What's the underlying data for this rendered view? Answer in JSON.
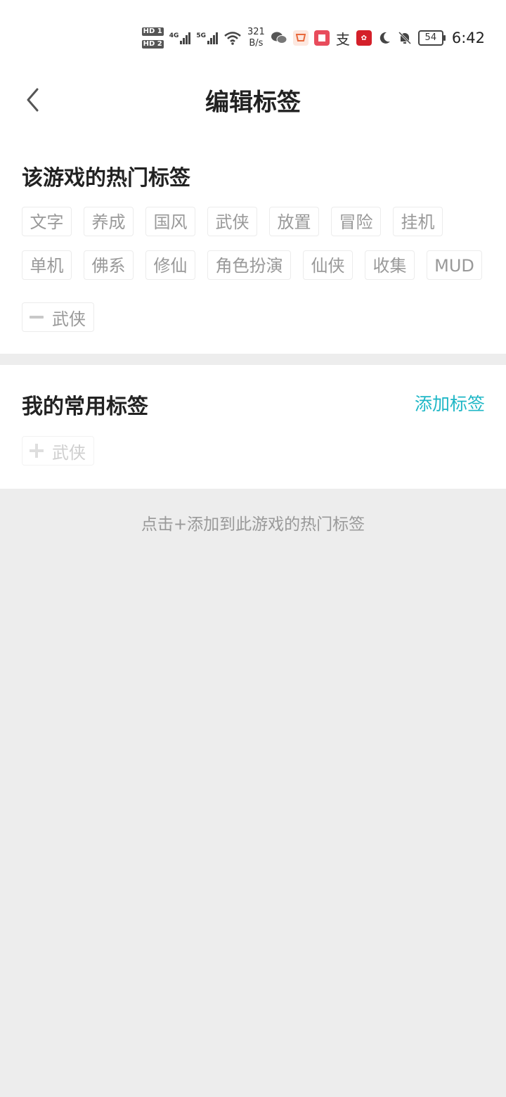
{
  "status_bar": {
    "hd1": "HD 1",
    "hd2": "HD 2",
    "net1": "4G",
    "net2": "5G",
    "speed_value": "321",
    "speed_unit": "B/s",
    "zhi_label": "支",
    "battery": "54",
    "time": "6:42"
  },
  "header": {
    "title": "编辑标签"
  },
  "hot_section": {
    "title": "该游戏的热门标签",
    "tags": [
      "文字",
      "养成",
      "国风",
      "武侠",
      "放置",
      "冒险",
      "挂机",
      "单机",
      "佛系",
      "修仙",
      "角色扮演",
      "仙侠",
      "收集",
      "MUD"
    ],
    "selected_tag": "武侠"
  },
  "my_section": {
    "title": "我的常用标签",
    "add_label": "添加标签",
    "tag": "武侠"
  },
  "hint": "点击+添加到此游戏的热门标签",
  "colors": {
    "accent": "#1fb7c6",
    "tag_text": "#999999",
    "background": "#ededed"
  }
}
